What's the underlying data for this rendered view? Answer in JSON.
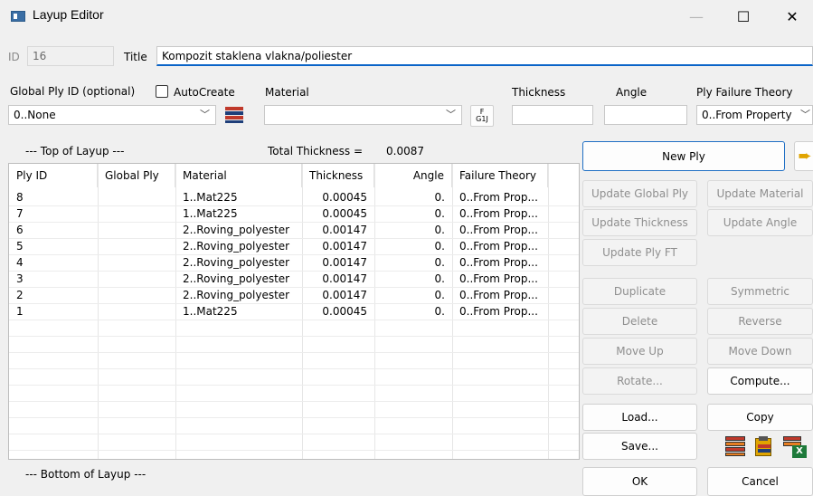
{
  "window": {
    "title": "Layup Editor"
  },
  "header": {
    "id_label": "ID",
    "id_value": "16",
    "title_label": "Title",
    "title_value": "Kompozit staklena vlakna/poliester"
  },
  "fields": {
    "global_ply_label": "Global Ply ID (optional)",
    "autocreate_label": "AutoCreate",
    "global_ply_value": "0..None",
    "material_label": "Material",
    "material_value": "",
    "thickness_label": "Thickness",
    "thickness_value": "",
    "angle_label": "Angle",
    "angle_value": "",
    "failure_label": "Ply Failure Theory",
    "failure_value": "0..From Property",
    "func_icon_text_top": "F",
    "func_icon_text_bottom": "G1J"
  },
  "layup": {
    "top_label": "--- Top of Layup ---",
    "bottom_label": "--- Bottom of Layup ---",
    "total_label": "Total Thickness =",
    "total_value": "0.0087",
    "columns": [
      "Ply ID",
      "Global Ply",
      "Material",
      "Thickness",
      "Angle",
      "Failure Theory"
    ],
    "rows": [
      {
        "ply_id": "8",
        "global_ply": "",
        "material": "1..Mat225",
        "thickness": "0.00045",
        "angle": "0.",
        "failure": "0..From Prop..."
      },
      {
        "ply_id": "7",
        "global_ply": "",
        "material": "1..Mat225",
        "thickness": "0.00045",
        "angle": "0.",
        "failure": "0..From Prop..."
      },
      {
        "ply_id": "6",
        "global_ply": "",
        "material": "2..Roving_polyester",
        "thickness": "0.00147",
        "angle": "0.",
        "failure": "0..From Prop..."
      },
      {
        "ply_id": "5",
        "global_ply": "",
        "material": "2..Roving_polyester",
        "thickness": "0.00147",
        "angle": "0.",
        "failure": "0..From Prop..."
      },
      {
        "ply_id": "4",
        "global_ply": "",
        "material": "2..Roving_polyester",
        "thickness": "0.00147",
        "angle": "0.",
        "failure": "0..From Prop..."
      },
      {
        "ply_id": "3",
        "global_ply": "",
        "material": "2..Roving_polyester",
        "thickness": "0.00147",
        "angle": "0.",
        "failure": "0..From Prop..."
      },
      {
        "ply_id": "2",
        "global_ply": "",
        "material": "2..Roving_polyester",
        "thickness": "0.00147",
        "angle": "0.",
        "failure": "0..From Prop..."
      },
      {
        "ply_id": "1",
        "global_ply": "",
        "material": "1..Mat225",
        "thickness": "0.00045",
        "angle": "0.",
        "failure": "0..From Prop..."
      }
    ]
  },
  "buttons": {
    "new_ply": "New Ply",
    "update_global_ply": "Update Global Ply",
    "update_material": "Update Material",
    "update_thickness": "Update Thickness",
    "update_angle": "Update Angle",
    "update_ply_ft": "Update Ply FT",
    "duplicate": "Duplicate",
    "symmetric": "Symmetric",
    "delete": "Delete",
    "reverse": "Reverse",
    "move_up": "Move Up",
    "move_down": "Move Down",
    "rotate": "Rotate...",
    "compute": "Compute...",
    "load": "Load...",
    "copy": "Copy",
    "save": "Save...",
    "ok": "OK",
    "cancel": "Cancel"
  },
  "icons": {
    "app": "app-window-icon",
    "layup_stack": "layup-stack-icon",
    "function": "function-icon",
    "arrow": "insert-arrow-icon",
    "export": "export-icons",
    "minimize": "minimize-icon",
    "maximize": "maximize-icon",
    "close": "close-icon"
  },
  "colors": {
    "accent": "#0a64c8",
    "table_bg": "#ffffff",
    "window_bg": "#f0f0f0"
  }
}
